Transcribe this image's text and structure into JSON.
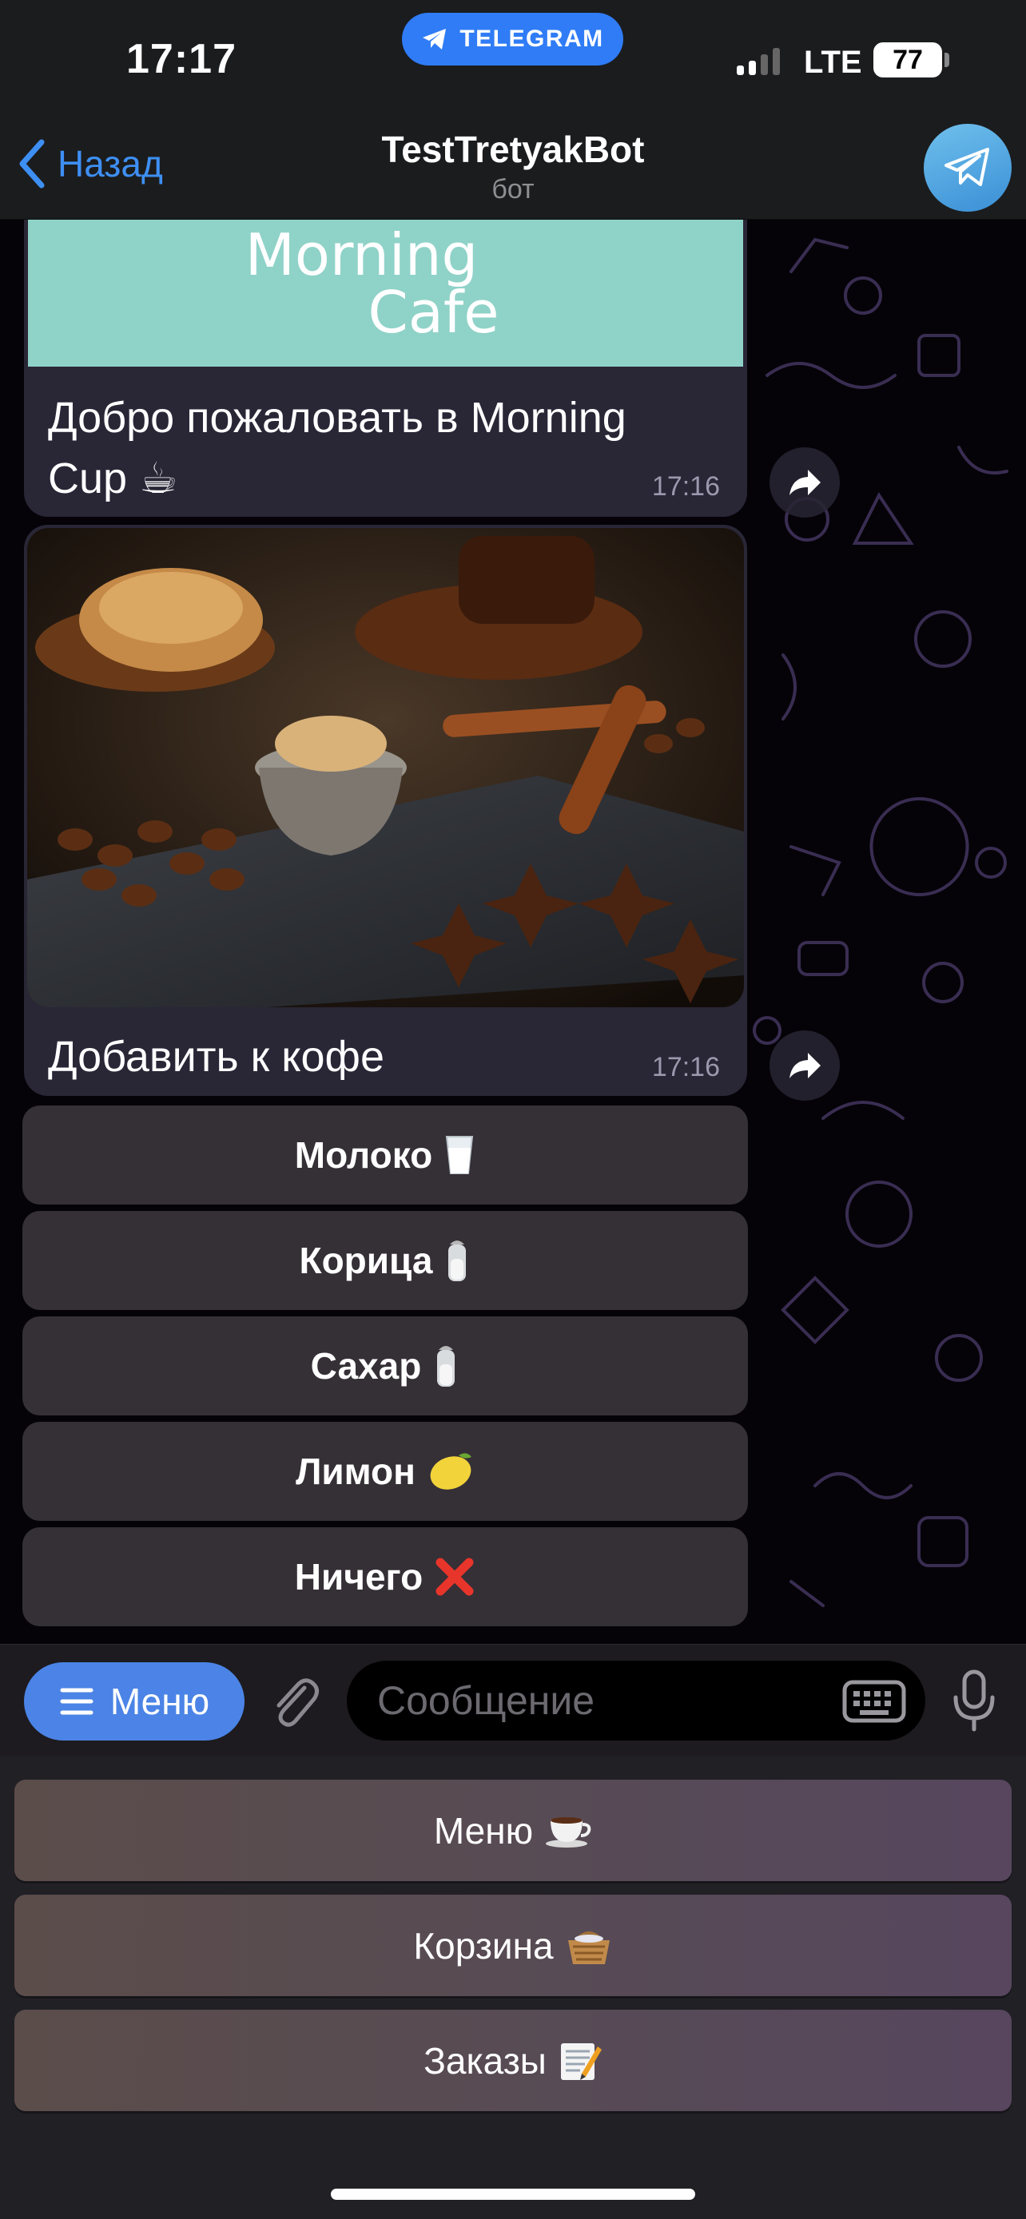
{
  "status_bar": {
    "time": "17:17",
    "app_pill": "TELEGRAM",
    "network": "LTE",
    "battery": "77"
  },
  "header": {
    "back_label": "Назад",
    "title": "TestTretyakBot",
    "subtitle": "бот",
    "back_icon": "chevron-left-icon",
    "avatar_icon": "telegram-plane-icon"
  },
  "messages": [
    {
      "image_caption_line1": "Morning",
      "image_caption_line2": "Cafe",
      "text": "Добро пожаловать в Morning Cup ☕",
      "time": "17:16"
    },
    {
      "image_description_icon": "coffee-spices-photo",
      "text": "Добавить к кофе",
      "time": "17:16"
    }
  ],
  "inline_keyboard": [
    {
      "label": "Молоко",
      "emoji": "milk-glass-icon"
    },
    {
      "label": "Корица",
      "emoji": "salt-shaker-icon"
    },
    {
      "label": "Сахар",
      "emoji": "salt-shaker-icon"
    },
    {
      "label": "Лимон",
      "emoji": "lemon-icon"
    },
    {
      "label": "Ничего",
      "emoji": "cross-mark-icon"
    }
  ],
  "input_bar": {
    "menu_label": "Меню",
    "placeholder": "Сообщение"
  },
  "reply_keyboard": [
    {
      "label": "Меню",
      "emoji": "coffee-cup-icon"
    },
    {
      "label": "Корзина",
      "emoji": "basket-icon"
    },
    {
      "label": "Заказы",
      "emoji": "memo-icon"
    }
  ],
  "colors": {
    "accent": "#2f7cf6",
    "menu_button": "#4b84e6",
    "bubble": "#292636",
    "inline_button": "#352f36"
  }
}
